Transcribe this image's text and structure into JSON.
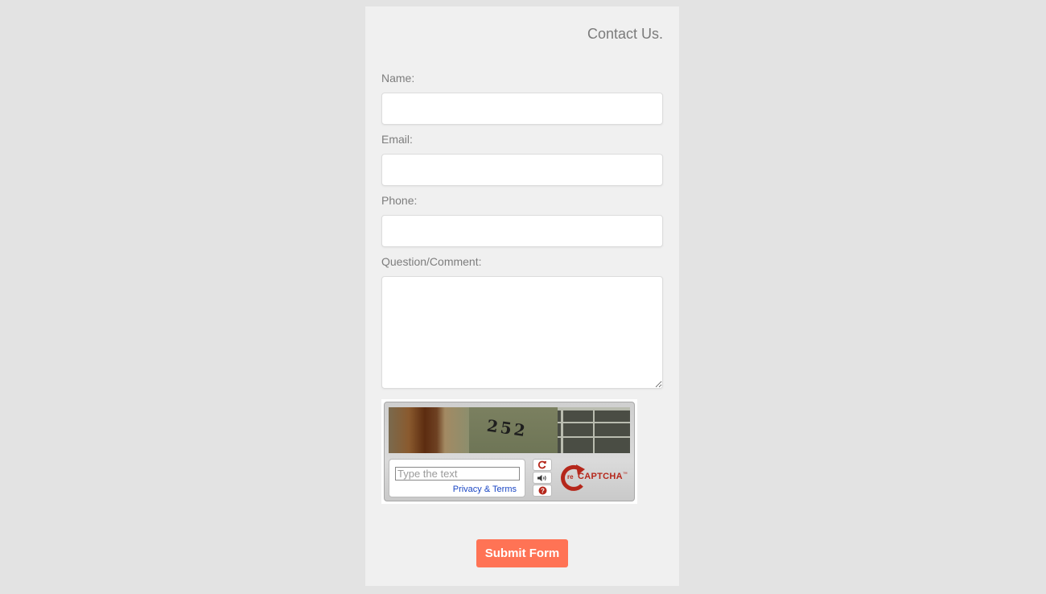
{
  "form": {
    "title": "Contact Us.",
    "fields": {
      "name_label": "Name:",
      "name_value": "",
      "email_label": "Email:",
      "email_value": "",
      "phone_label": "Phone:",
      "phone_value": "",
      "comment_label": "Question/Comment:",
      "comment_value": ""
    },
    "submit_label": "Submit Form"
  },
  "captcha": {
    "image_text": "252",
    "input_placeholder": "Type the text",
    "input_value": "",
    "privacy_label": "Privacy & Terms",
    "brand_prefix": "re",
    "brand_name": "CAPTCHA",
    "trademark": "™",
    "icons": [
      "refresh-icon",
      "audio-icon",
      "help-icon"
    ]
  },
  "colors": {
    "page_background": "#e3e3e3",
    "panel_background": "#f0f0f0",
    "submit_button": "#ff7355",
    "captcha_brand": "#b5271b",
    "link": "#1a46c4"
  }
}
